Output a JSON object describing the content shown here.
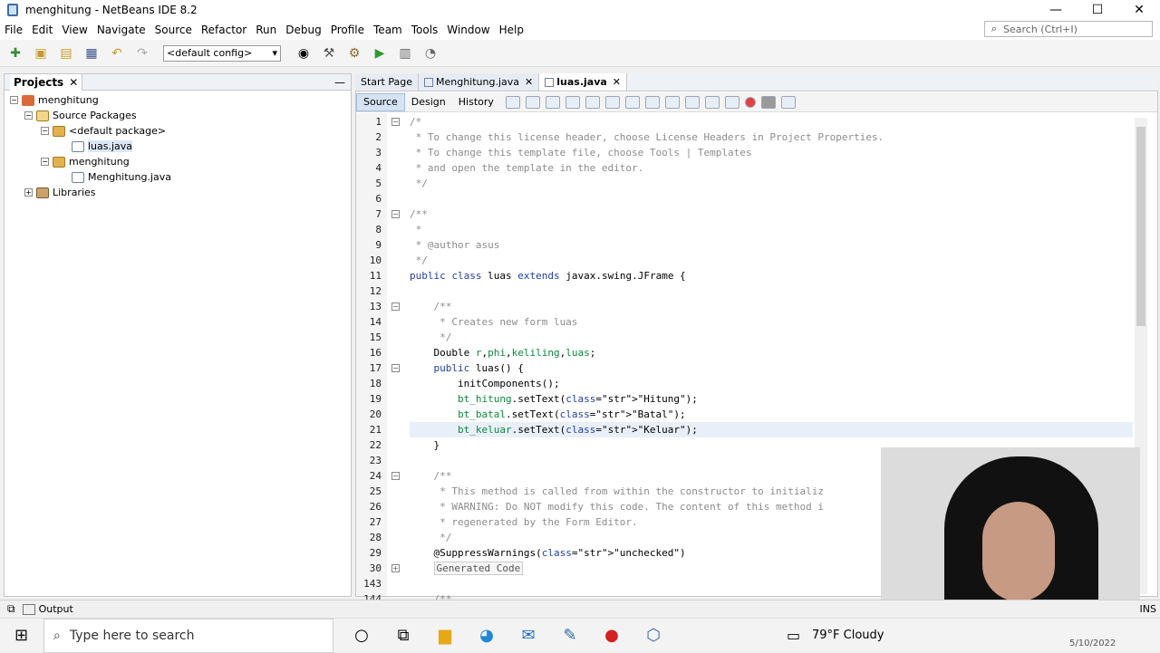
{
  "window": {
    "title": "menghitung - NetBeans IDE 8.2",
    "min": "—",
    "max": "☐",
    "close": "✕"
  },
  "menu": [
    "File",
    "Edit",
    "View",
    "Navigate",
    "Source",
    "Refactor",
    "Run",
    "Debug",
    "Profile",
    "Team",
    "Tools",
    "Window",
    "Help"
  ],
  "search": {
    "placeholder": "Search (Ctrl+I)"
  },
  "toolbar": {
    "config": "<default config>"
  },
  "projects": {
    "tab": "Projects",
    "close": "✕",
    "minimize": "—",
    "items": [
      "menghitung",
      "Source Packages",
      "<default package>",
      "luas.java",
      "menghitung",
      "Menghitung.java",
      "Libraries"
    ]
  },
  "editor": {
    "tabs": [
      "Start Page",
      "Menghitung.java",
      "luas.java"
    ],
    "views": [
      "Source",
      "Design",
      "History"
    ],
    "lines": [
      {
        "n": "1",
        "t": "/*"
      },
      {
        "n": "2",
        "t": " * To change this license header, choose License Headers in Project Properties."
      },
      {
        "n": "3",
        "t": " * To change this template file, choose Tools | Templates"
      },
      {
        "n": "4",
        "t": " * and open the template in the editor."
      },
      {
        "n": "5",
        "t": " */"
      },
      {
        "n": "6",
        "t": ""
      },
      {
        "n": "7",
        "t": "/**"
      },
      {
        "n": "8",
        "t": " *"
      },
      {
        "n": "9",
        "t": " * @author asus"
      },
      {
        "n": "10",
        "t": " */"
      },
      {
        "n": "11",
        "t": "public class luas extends javax.swing.JFrame {"
      },
      {
        "n": "12",
        "t": ""
      },
      {
        "n": "13",
        "t": "    /**"
      },
      {
        "n": "14",
        "t": "     * Creates new form luas"
      },
      {
        "n": "15",
        "t": "     */"
      },
      {
        "n": "16",
        "t": "    Double r,phi,keliling,luas;"
      },
      {
        "n": "17",
        "t": "    public luas() {"
      },
      {
        "n": "18",
        "t": "        initComponents();"
      },
      {
        "n": "19",
        "t": "        bt_hitung.setText(\"Hitung\");"
      },
      {
        "n": "20",
        "t": "        bt_batal.setText(\"Batal\");"
      },
      {
        "n": "21",
        "t": "        bt_keluar.setText(\"Keluar\");"
      },
      {
        "n": "22",
        "t": "    }"
      },
      {
        "n": "23",
        "t": ""
      },
      {
        "n": "24",
        "t": "    /**"
      },
      {
        "n": "25",
        "t": "     * This method is called from within the constructor to initializ"
      },
      {
        "n": "26",
        "t": "     * WARNING: Do NOT modify this code. The content of this method i"
      },
      {
        "n": "27",
        "t": "     * regenerated by the Form Editor."
      },
      {
        "n": "28",
        "t": "     */"
      },
      {
        "n": "29",
        "t": "    @SuppressWarnings(\"unchecked\")"
      },
      {
        "n": "30",
        "t": "    Generated Code"
      },
      {
        "n": "143",
        "t": ""
      },
      {
        "n": "144",
        "t": "    /**"
      }
    ]
  },
  "output": {
    "label": "Output",
    "ins": "INS"
  },
  "taskbar": {
    "search": "Type here to search",
    "weather": "79°F  Cloudy",
    "date": "5/10/2022"
  }
}
